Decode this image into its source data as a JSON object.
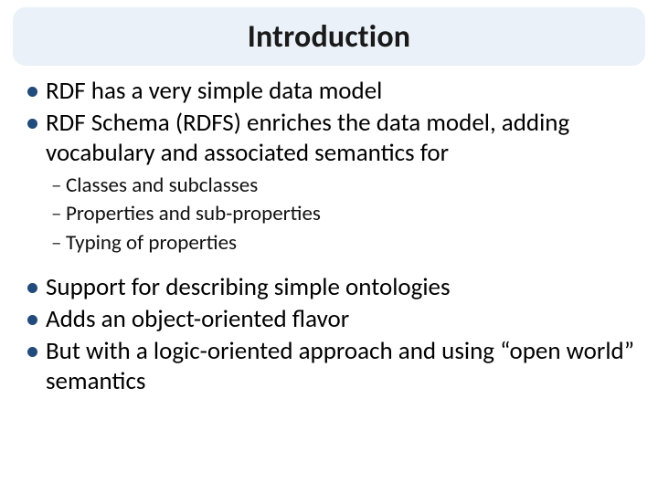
{
  "title": "Introduction",
  "bullets": {
    "b1": "RDF has a very simple data model",
    "b2": "RDF Schema (RDFS) enriches the data model, adding vocabulary and associated semantics for",
    "b2_sub": {
      "s1": "Classes and subclasses",
      "s2": "Properties and sub-properties",
      "s3": "Typing of properties"
    },
    "b3": "Support for describing simple ontologies",
    "b4": "Adds an object-oriented flavor",
    "b5": "But with a logic-oriented approach and using “open world” semantics"
  }
}
